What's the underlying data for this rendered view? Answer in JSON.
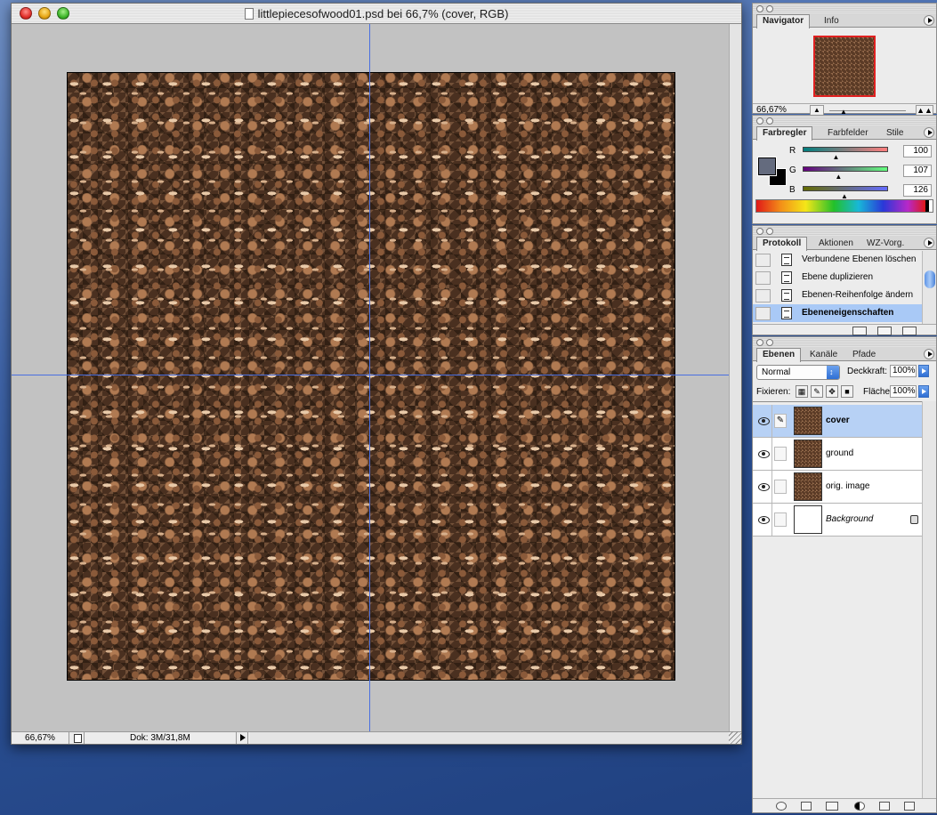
{
  "document": {
    "title": "littlepiecesofwood01.psd bei 66,7% (cover, RGB)",
    "status_zoom": "66,67%",
    "status_doc": "Dok: 3M/31,8M"
  },
  "navigator": {
    "tabs": [
      "Navigator",
      "Info"
    ],
    "zoom": "66,67%",
    "zoom_out_icon": "small-mountain-icon",
    "zoom_in_icon": "large-mountain-icon"
  },
  "color": {
    "tabs": [
      "Farbregler",
      "Farbfelder",
      "Stile"
    ],
    "foreground": "#646b7e",
    "background": "#000000",
    "channels": [
      {
        "label": "R",
        "value": "100",
        "level": 0.39
      },
      {
        "label": "G",
        "value": "107",
        "level": 0.42
      },
      {
        "label": "B",
        "value": "126",
        "level": 0.49
      }
    ]
  },
  "history": {
    "tabs": [
      "Protokoll",
      "Aktionen",
      "WZ-Vorg."
    ],
    "items": [
      "Verbundene Ebenen löschen",
      "Ebene duplizieren",
      "Ebenen-Reihenfolge ändern",
      "Ebeneneigenschaften"
    ],
    "active_index": 3
  },
  "layers": {
    "tabs": [
      "Ebenen",
      "Kanäle",
      "Pfade"
    ],
    "blend_mode": "Normal",
    "opacity_label": "Deckkraft:",
    "opacity": "100%",
    "lock_label": "Fixieren:",
    "fill_label": "Fläche",
    "fill": "100%",
    "items": [
      {
        "name": "cover",
        "active": true
      },
      {
        "name": "ground",
        "active": false
      },
      {
        "name": "orig. image",
        "active": false
      },
      {
        "name": "Background",
        "active": false,
        "locked": true
      }
    ]
  },
  "colors": {
    "accent": "#3f78d8",
    "selection": "#b7d1f5",
    "guide": "#4a6fe0"
  }
}
